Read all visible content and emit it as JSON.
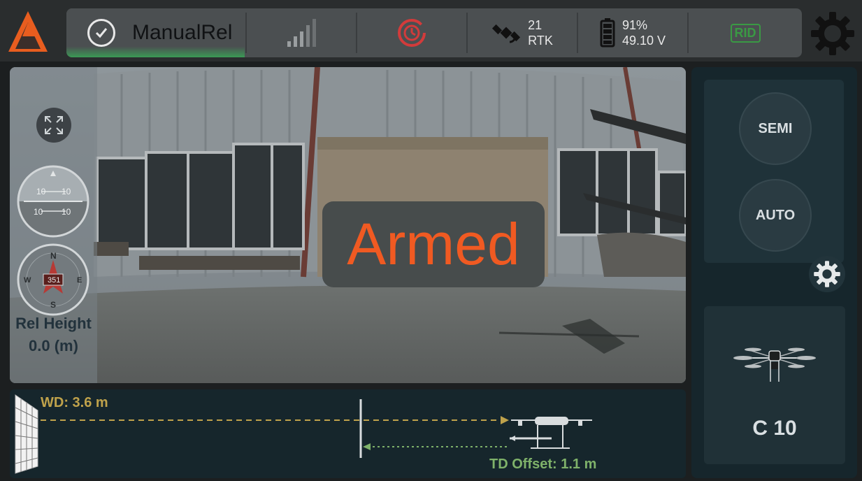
{
  "topbar": {
    "logo": "app-logo",
    "mode": {
      "label": "ManualRel",
      "icon": "check-circle-icon",
      "status_color": "#3b9a55"
    },
    "signal_icon": "signal-bars-icon",
    "rtk_icon": "return-home-icon",
    "gps": {
      "icon": "satellite-icon",
      "satellites": "21",
      "fix": "RTK"
    },
    "battery": {
      "icon": "battery-icon",
      "percent": "91%",
      "voltage": "49.10 V"
    },
    "remote_id": {
      "label": "RID",
      "color": "#3a9a44"
    },
    "settings_icon": "gear-icon"
  },
  "video": {
    "status_text": "Armed",
    "status_color": "#f05a22",
    "expand_icon": "expand-icon",
    "attitude": {
      "pitch_upper": "10",
      "pitch_lower": "10",
      "pitch_upper_left": "10",
      "pitch_lower_left": "10"
    },
    "compass": {
      "heading": "351",
      "n": "N",
      "s": "S",
      "e": "E",
      "w": "W"
    },
    "rel_height": {
      "label": "Rel Height",
      "value": "0.0 (m)"
    }
  },
  "distance_panel": {
    "wd_label": "WD: 3.6 m",
    "td_label": "TD Offset: 1.1 m",
    "wall_icon": "wall-icon",
    "drone_icon": "drone-side-icon"
  },
  "right_panel": {
    "semi_label": "SEMI",
    "auto_label": "AUTO",
    "settings_icon": "gear-icon",
    "drone_icon": "drone-top-icon",
    "drone_name": "C 10"
  },
  "colors": {
    "accent_orange": "#f05a22",
    "ok_green": "#3b9a55",
    "wd_yellow": "#bfa24b",
    "td_green": "#7fb26a"
  }
}
